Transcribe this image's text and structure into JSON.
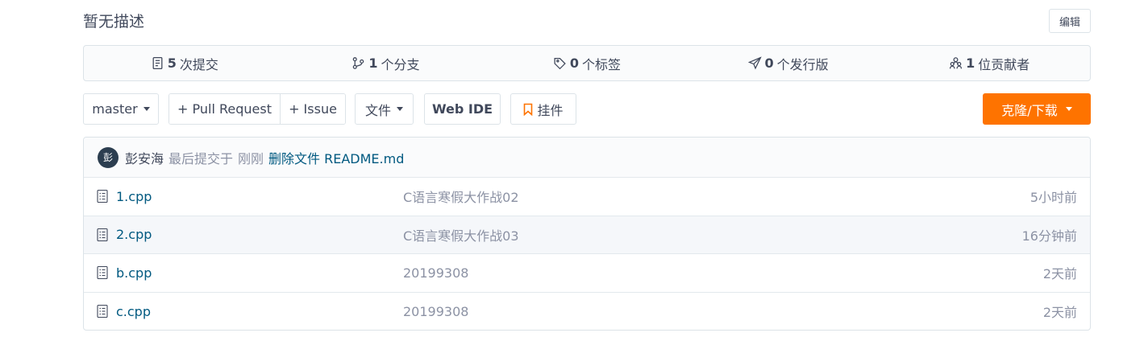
{
  "description": {
    "text": "暂无描述",
    "edit_label": "编辑"
  },
  "stats": [
    {
      "icon": "commit-icon",
      "count": "5",
      "label": "次提交"
    },
    {
      "icon": "branch-icon",
      "count": "1",
      "label": "个分支"
    },
    {
      "icon": "tag-icon",
      "count": "0",
      "label": "个标签"
    },
    {
      "icon": "release-icon",
      "count": "0",
      "label": "个发行版"
    },
    {
      "icon": "contributors-icon",
      "count": "1",
      "label": "位贡献者"
    }
  ],
  "toolbar": {
    "branch": "master",
    "pull_request": "+ Pull Request",
    "issue": "+ Issue",
    "files": "文件",
    "web_ide": "Web IDE",
    "widget": "挂件",
    "clone": "克隆/下载"
  },
  "last_commit": {
    "avatar_text": "彭",
    "author": "彭安海",
    "prefix": "最后提交于",
    "time": "刚刚",
    "message": "删除文件 README.md"
  },
  "files": [
    {
      "name": "1.cpp",
      "message": "C语言寒假大作战02",
      "time": "5小时前"
    },
    {
      "name": "2.cpp",
      "message": "C语言寒假大作战03",
      "time": "16分钟前"
    },
    {
      "name": "b.cpp",
      "message": "20199308",
      "time": "2天前"
    },
    {
      "name": "c.cpp",
      "message": "20199308",
      "time": "2天前"
    }
  ],
  "colors": {
    "accent": "#fe7300",
    "link": "#005980",
    "muted": "#8c92a4"
  }
}
